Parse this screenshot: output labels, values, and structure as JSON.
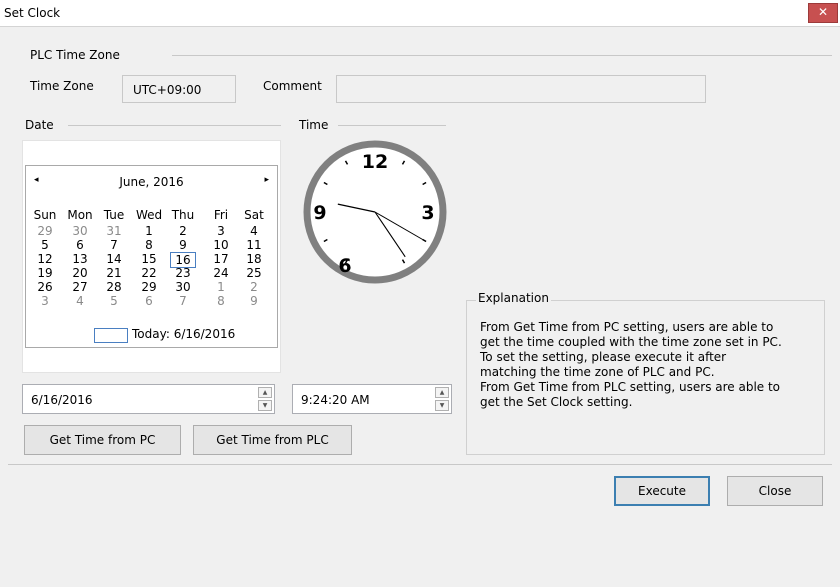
{
  "window": {
    "title": "Set Clock",
    "close_glyph": "✕"
  },
  "timezone_group": {
    "title": "PLC Time Zone",
    "time_zone_label": "Time Zone",
    "time_zone_value": "UTC+09:00",
    "comment_label": "Comment",
    "comment_value": ""
  },
  "date_group": {
    "title": "Date"
  },
  "time_group": {
    "title": "Time"
  },
  "calendar": {
    "month_label": "June, 2016",
    "prev_glyph": "◂",
    "next_glyph": "▸",
    "weekdays": [
      "Sun",
      "Mon",
      "Tue",
      "Wed",
      "Thu",
      "Fri",
      "Sat"
    ],
    "weeks": [
      [
        "29",
        "30",
        "31",
        "1",
        "2",
        "3",
        "4"
      ],
      [
        "5",
        "6",
        "7",
        "8",
        "9",
        "10",
        "11"
      ],
      [
        "12",
        "13",
        "14",
        "15",
        "16",
        "17",
        "18"
      ],
      [
        "19",
        "20",
        "21",
        "22",
        "23",
        "24",
        "25"
      ],
      [
        "26",
        "27",
        "28",
        "29",
        "30",
        "1",
        "2"
      ],
      [
        "3",
        "4",
        "5",
        "6",
        "7",
        "8",
        "9"
      ]
    ],
    "selected_day": "16",
    "today_label": "Today: 6/16/2016"
  },
  "clock": {
    "n12": "12",
    "n3": "3",
    "n6": "6",
    "n9": "9",
    "hour": 9,
    "minute": 24,
    "second": 20
  },
  "date_input": {
    "value": "6/16/2016"
  },
  "time_input": {
    "value": "9:24:20 AM"
  },
  "buttons": {
    "get_from_pc": "Get Time from PC",
    "get_from_plc": "Get Time from PLC",
    "execute": "Execute",
    "close": "Close"
  },
  "explanation": {
    "title": "Explanation",
    "lines": [
      "From Get Time from PC setting, users are able to",
      "get the time coupled with the time zone set in PC.",
      "To set the setting, please execute it after",
      "matching the time zone of PLC and PC.",
      "From Get Time from PLC setting, users are able to",
      "get the Set Clock setting."
    ]
  }
}
